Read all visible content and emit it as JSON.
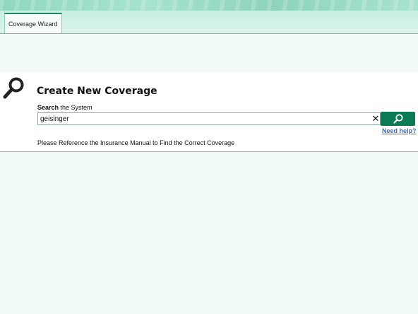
{
  "tabs": [
    {
      "label": "Coverage Wizard",
      "active": true
    }
  ],
  "panel": {
    "title": "Create New Coverage",
    "search_label_bold": "Search",
    "search_label_rest": " the System",
    "search_value": "geisinger",
    "help_link": "Need help?",
    "reference_text": "Please Reference the Insurance Manual to Find the Correct Coverage"
  },
  "icons": {
    "page_icon": "search-icon",
    "clear": "close-icon",
    "search_button": "search-icon"
  },
  "colors": {
    "accent": "#0b7a55",
    "link": "#3f6fb5",
    "banner": "#8fd8c0",
    "background": "#f3fbf8"
  }
}
